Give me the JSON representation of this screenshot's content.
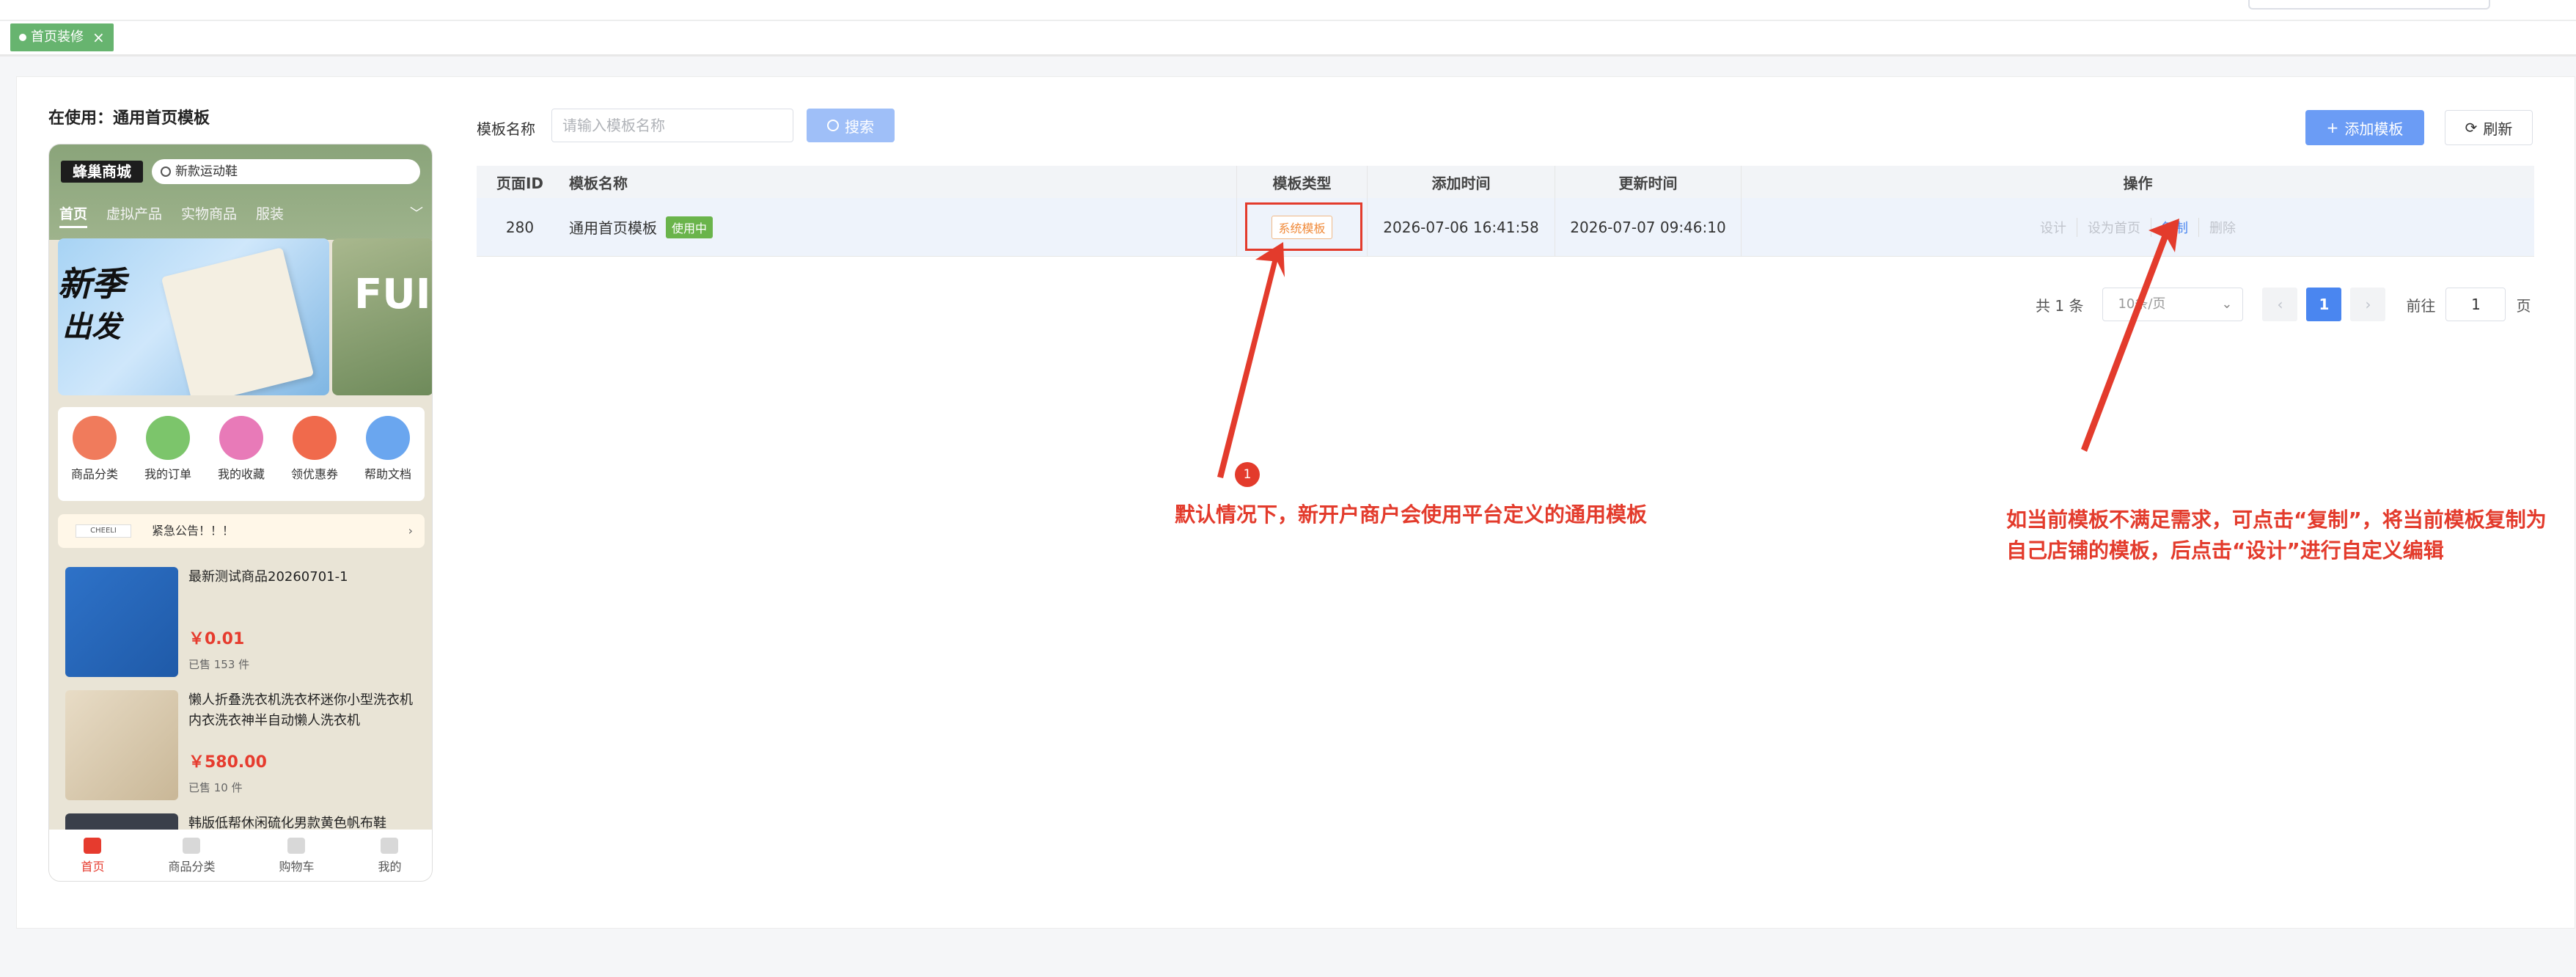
{
  "tab": {
    "label": "首页装修",
    "close": "×"
  },
  "preview": {
    "using_label": "在使用：通用首页模板",
    "logo": "蜂巢商城",
    "search_placeholder": "新款运动鞋",
    "nav": [
      "首页",
      "虚拟产品",
      "实物商品",
      "服装"
    ],
    "banner_text1": "新季",
    "banner_text2": "出发",
    "banner2_text": "FUI",
    "icons": [
      {
        "label": "商品分类",
        "color": "#f07b5c"
      },
      {
        "label": "我的订单",
        "color": "#7cc56b"
      },
      {
        "label": "我的收藏",
        "color": "#e87ab8"
      },
      {
        "label": "领优惠券",
        "color": "#f06a4c"
      },
      {
        "label": "帮助文档",
        "color": "#6aa6ef"
      }
    ],
    "notice_brand": "CHEELI",
    "notice": "紧急公告！！！",
    "goods": [
      {
        "name": "最新测试商品20260701-1",
        "price": "￥0.01",
        "sold": "已售 153 件",
        "color": "#2e72c8"
      },
      {
        "name": "懒人折叠洗衣机洗衣杯迷你小型洗衣机内衣洗衣神半自动懒人洗衣机",
        "price": "￥580.00",
        "sold": "已售 10 件",
        "color": "#d9c8ad"
      },
      {
        "name": "韩版低帮休闲硫化男款黄色帆布鞋",
        "price": "",
        "sold": "",
        "color": "#3a3f4a"
      }
    ],
    "tabbar": [
      "首页",
      "商品分类",
      "购物车",
      "我的"
    ]
  },
  "filter": {
    "label": "模板名称",
    "placeholder": "请输入模板名称",
    "search_btn": "搜索",
    "add_btn": "添加模板",
    "refresh_btn": "刷新"
  },
  "table": {
    "headers": [
      "页面ID",
      "模板名称",
      "模板类型",
      "添加时间",
      "更新时间",
      "操作"
    ],
    "row": {
      "id": "280",
      "name": "通用首页模板",
      "status": "使用中",
      "type": "系统模板",
      "created": "2026-07-06 16:41:58",
      "updated": "2026-07-07 09:46:10",
      "ops": [
        "设计",
        "设为首页",
        "复制",
        "删除"
      ]
    }
  },
  "pagination": {
    "total": "共 1 条",
    "size": "10条/页",
    "prev": "‹",
    "current": "1",
    "next": "›",
    "goto": "前往",
    "goto_value": "1",
    "page_unit": "页"
  },
  "annotations": {
    "number": "1",
    "text1": "默认情况下，新开户商户会使用平台定义的通用模板",
    "text2": "如当前模板不满足需求，可点击“复制”，将当前模板复制为自己店铺的模板，后点击“设计”进行自定义编辑",
    "color": "#e33b2c"
  }
}
